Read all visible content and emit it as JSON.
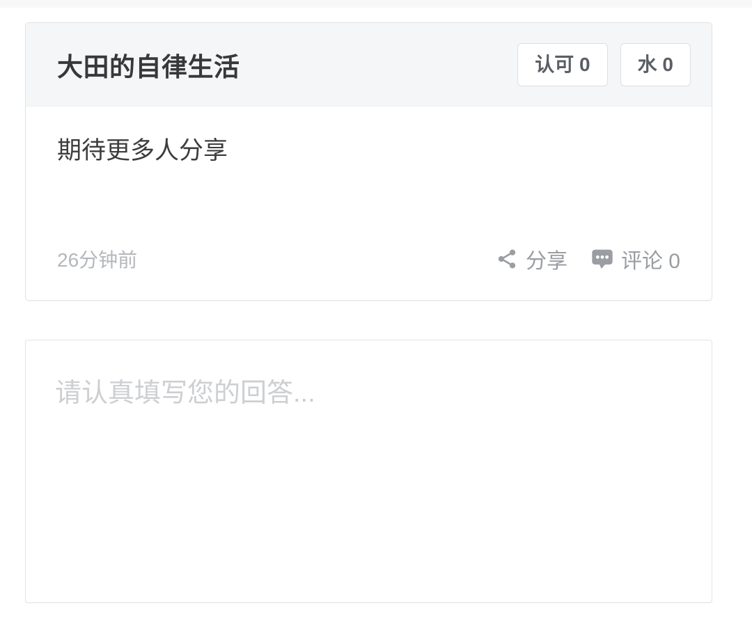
{
  "question_card": {
    "title": "大田的自律生活",
    "actions": [
      {
        "label": "认可 0",
        "name": "approve-button"
      },
      {
        "label": "水 0",
        "name": "water-button"
      }
    ],
    "body_text": "期待更多人分享",
    "timestamp": "26分钟前",
    "footer": {
      "share_label": "分享",
      "share_icon": "share-icon",
      "comment_label": "评论 0",
      "comment_icon": "comment-bubble-icon"
    }
  },
  "answer_box": {
    "value": "",
    "placeholder": "请认真填写您的回答..."
  },
  "colors": {
    "page_background": "#ffffff",
    "top_strip": "#f8f8f8",
    "card_header_background": "#f5f6f7",
    "card_border": "#e0e2e4",
    "title_text": "#383838",
    "body_text": "#3d3d3d",
    "muted_text": "#9a9da1",
    "timestamp_text": "#b4b7bb",
    "placeholder_text": "#cdcfd2",
    "button_text": "#5b5f63",
    "button_border": "#dcdfe2"
  }
}
